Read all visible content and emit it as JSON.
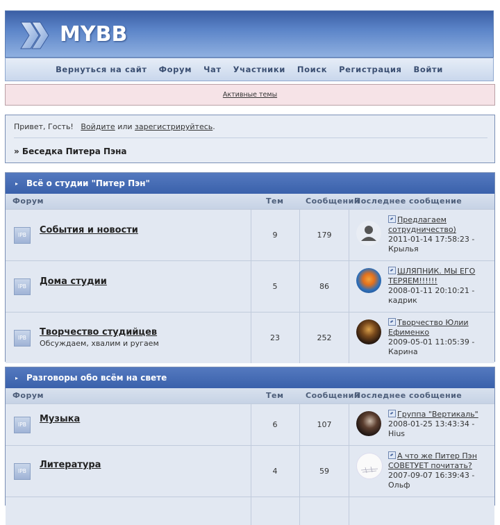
{
  "header": {
    "logo_text": "MYBB"
  },
  "nav": [
    {
      "label": "Вернуться на сайт",
      "name": "nav-back-to-site"
    },
    {
      "label": "Форум",
      "name": "nav-forum"
    },
    {
      "label": "Чат",
      "name": "nav-chat"
    },
    {
      "label": "Участники",
      "name": "nav-members"
    },
    {
      "label": "Поиск",
      "name": "nav-search"
    },
    {
      "label": "Регистрация",
      "name": "nav-register"
    },
    {
      "label": "Войти",
      "name": "nav-login"
    }
  ],
  "active_topics": "Активные темы",
  "greeting": {
    "hello": "Привет, Гость!",
    "login_link": "Войдите",
    "or": "или",
    "register_link": "зарегистрируйтесь",
    "dot": "."
  },
  "breadcrumb": "» Беседка Питера Пэна",
  "columns": {
    "forum": "Форум",
    "topics": "Тем",
    "posts": "Сообщений",
    "last_post": "Последнее сообщение"
  },
  "categories": [
    {
      "title": "Всё о студии \"Питер Пэн\"",
      "forums": [
        {
          "name": "События и новости",
          "desc": "",
          "topics": "9",
          "posts": "179",
          "last_title": "Предлагаем сотрудничество)",
          "last_date": "2011-01-14 17:58:23 -",
          "last_user": "Крылья",
          "avatar": "default-user-avatar"
        },
        {
          "name": "Дома студии",
          "desc": "",
          "topics": "5",
          "posts": "86",
          "last_title": "ШЛЯПНИК. МЫ ЕГО ТЕРЯЕМ!!!!!!",
          "last_date": "2008-01-11 20:10:21 -",
          "last_user": "кадрик",
          "avatar": "orange-blue-avatar"
        },
        {
          "name": "Творчество студийцев",
          "desc": "Обсуждаем, хвалим и ругаем",
          "topics": "23",
          "posts": "252",
          "last_title": "Творчество Юлии Ефименко",
          "last_date": "2009-05-01 11:05:39 -",
          "last_user": "Карина",
          "avatar": "dark-portrait-avatar"
        }
      ]
    },
    {
      "title": "Разговоры обо всём на свете",
      "forums": [
        {
          "name": "Музыка",
          "desc": "",
          "topics": "6",
          "posts": "107",
          "last_title": "Группа \"Вертикаль\"",
          "last_date": "2008-01-25 13:43:34 -",
          "last_user": "Hius",
          "avatar": "dark-photo-avatar"
        },
        {
          "name": "Литература",
          "desc": "",
          "topics": "4",
          "posts": "59",
          "last_title": "А что же Питер Пэн СОВЕТУЕТ почитать?",
          "last_date": "2007-09-07 16:39:43 -",
          "last_user": "Ольф",
          "avatar": "white-sketch-avatar"
        }
      ]
    }
  ],
  "colors": {
    "cat_header": "#3a61ab",
    "row_bg": "#e2e8f2",
    "alert_bg": "#f6e3e7"
  }
}
